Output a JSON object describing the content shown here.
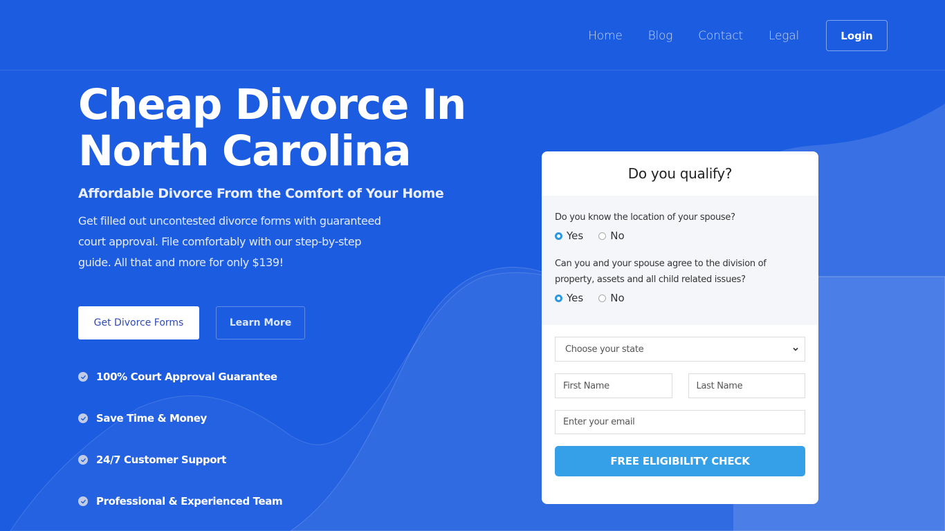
{
  "colors": {
    "background": "#1c5ce0",
    "accent_button": "#35a0e8",
    "radio_selected": "#2a97e3",
    "card_background": "#ffffff",
    "questions_background": "#f4f6f9"
  },
  "nav": {
    "items": [
      {
        "label": "Home"
      },
      {
        "label": "Blog"
      },
      {
        "label": "Contact"
      },
      {
        "label": "Legal"
      }
    ],
    "login_label": "Login"
  },
  "hero": {
    "title_line1": "Cheap Divorce In",
    "title_line2": "North Carolina",
    "subtitle": "Affordable Divorce From the Comfort of Your Home",
    "description": "Get filled out uncontested divorce forms with guaranteed court approval. File comfortably with our step-by-step guide. All that and more for only $139!",
    "primary_button": "Get Divorce Forms",
    "secondary_button": "Learn More"
  },
  "features": [
    {
      "icon": "check-circle-icon",
      "label": "100% Court Approval Guarantee"
    },
    {
      "icon": "check-circle-icon",
      "label": "Save Time & Money"
    },
    {
      "icon": "check-circle-icon",
      "label": "24/7 Customer Support"
    },
    {
      "icon": "check-circle-icon",
      "label": "Professional & Experienced Team"
    }
  ],
  "form": {
    "title": "Do you qualify?",
    "questions": [
      {
        "text": "Do you know the location of your spouse?",
        "options": [
          "Yes",
          "No"
        ],
        "selected": "Yes"
      },
      {
        "text": "Can you and your spouse agree to the division of property, assets and all child related issues?",
        "options": [
          "Yes",
          "No"
        ],
        "selected": "Yes"
      }
    ],
    "state_select": {
      "value": "Choose your state"
    },
    "first_name": {
      "placeholder": "First Name",
      "value": ""
    },
    "last_name": {
      "placeholder": "Last Name",
      "value": ""
    },
    "email": {
      "placeholder": "Enter your email",
      "value": ""
    },
    "submit_label": "FREE ELIGIBILITY CHECK"
  }
}
